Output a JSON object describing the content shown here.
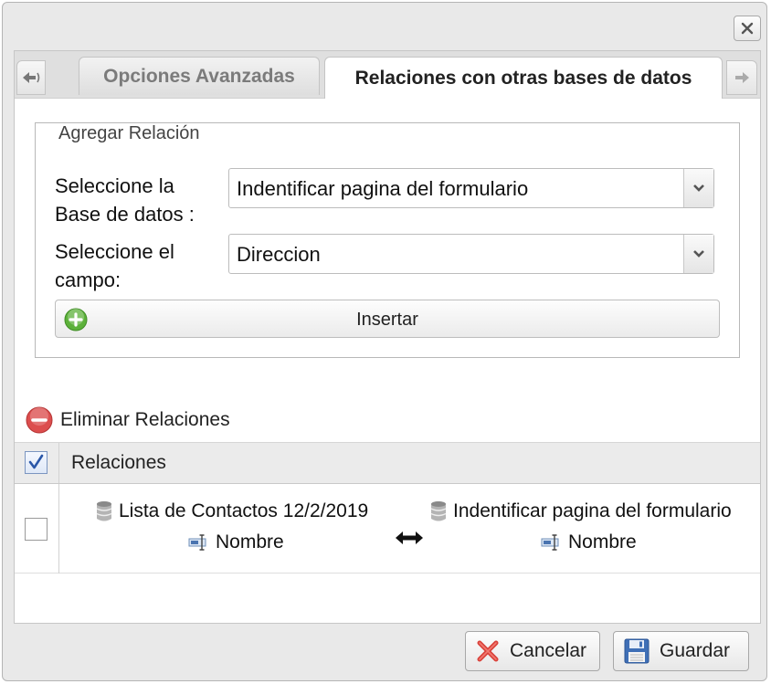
{
  "tabs": {
    "inactive_label": "Opciones Avanzadas",
    "active_label": "Relaciones con otras bases de datos"
  },
  "agregar": {
    "legend": "Agregar Relación",
    "db_label_line1": "Seleccione la",
    "db_label_line2": "Base de datos :",
    "db_value": "Indentificar pagina del formulario",
    "field_label_line1": "Seleccione el",
    "field_label_line2": "campo:",
    "field_value": "Direccion",
    "insert_label": "Insertar"
  },
  "delete_label": "Eliminar Relaciones",
  "grid": {
    "header": "Relaciones",
    "header_checked": true,
    "rows": [
      {
        "checked": false,
        "source_db": "Lista de Contactos 12/2/2019",
        "source_field": "Nombre",
        "target_db": "Indentificar pagina del formulario",
        "target_field": "Nombre"
      }
    ]
  },
  "footer": {
    "cancel_label": "Cancelar",
    "save_label": "Guardar"
  },
  "icons": {
    "close": "close-icon",
    "tab_left": "arrow-left-icon",
    "tab_right": "arrow-right-icon",
    "dropdown": "chevron-down-icon",
    "insert": "add-circle-icon",
    "delete": "remove-circle-icon",
    "database": "database-icon",
    "field": "text-field-icon",
    "relation": "double-arrow-icon",
    "cancel": "x-mark-icon",
    "save": "floppy-disk-icon"
  },
  "colors": {
    "insert_icon": "#5cb13a",
    "delete_icon": "#dc4e4e",
    "cancel_icon": "#d9413a",
    "save_icon": "#3f6fb6"
  }
}
